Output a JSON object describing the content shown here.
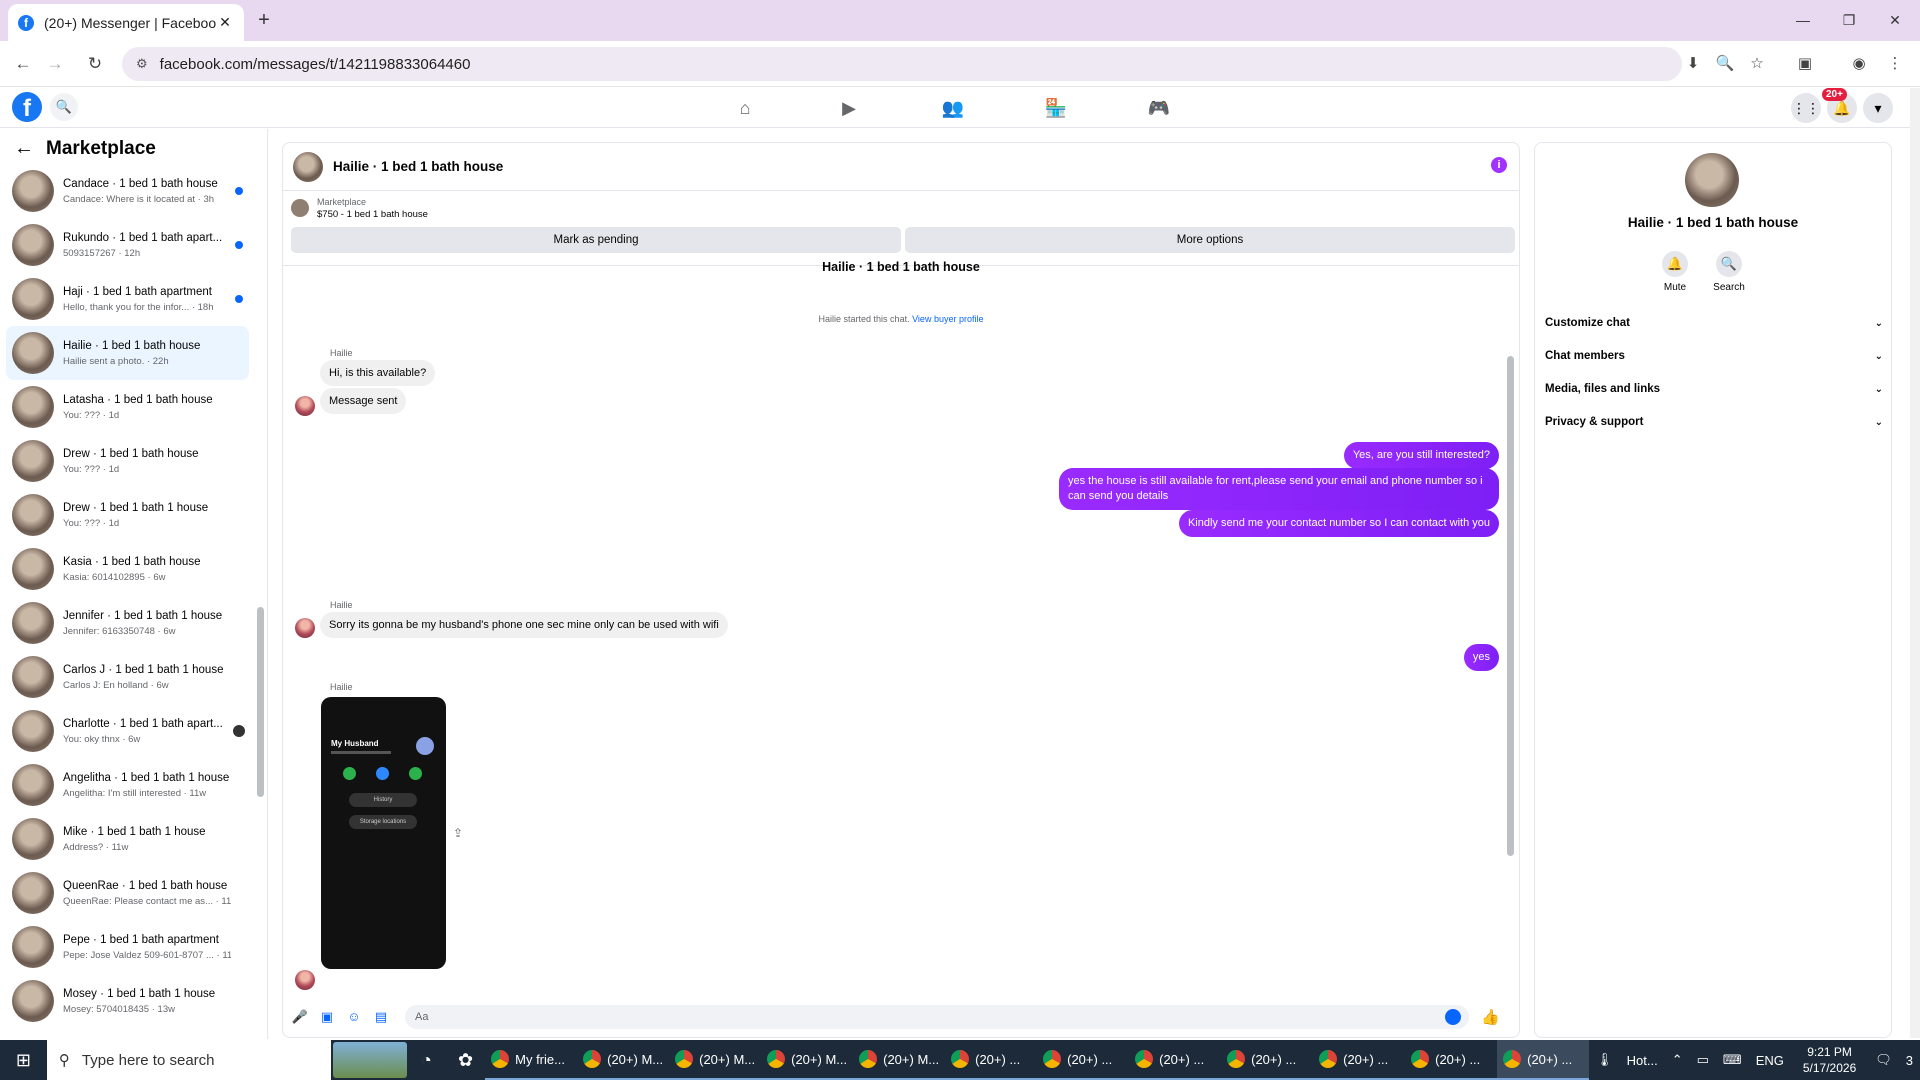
{
  "browser": {
    "tab_title": "(20+) Messenger | Facebook",
    "tab_close": "✕",
    "new_tab": "+",
    "url": "facebook.com/messages/t/1421198833064460",
    "win_min": "—",
    "win_max": "❐",
    "win_close": "✕"
  },
  "fb": {
    "logo": "f",
    "notif_count": "20+"
  },
  "sidebar": {
    "title": "Marketplace",
    "conversations": [
      {
        "name": "Candace · 1 bed 1 bath house",
        "preview": "Candace: Where is it located at · 3h",
        "unread": true
      },
      {
        "name": "Rukundo · 1 bed 1 bath apart...",
        "preview": "5093157267 · 12h",
        "unread": true
      },
      {
        "name": "Haji · 1 bed 1 bath apartment",
        "preview": "Hello, thank you for the infor... · 18h",
        "unread": true
      },
      {
        "name": "Hailie · 1 bed 1 bath house",
        "preview": "Hailie sent a photo. · 22h",
        "active": true
      },
      {
        "name": "Latasha · 1 bed 1 bath house",
        "preview": "You: ??? · 1d"
      },
      {
        "name": "Drew · 1 bed 1 bath house",
        "preview": "You: ??? · 1d"
      },
      {
        "name": "Drew · 1 bed 1 bath 1 house",
        "preview": "You: ??? · 1d"
      },
      {
        "name": "Kasia · 1 bed 1 bath house",
        "preview": "Kasia: 6014102895 · 6w"
      },
      {
        "name": "Jennifer · 1 bed 1 bath 1 house",
        "preview": "Jennifer: 6163350748 · 6w"
      },
      {
        "name": "Carlos J · 1 bed 1 bath 1 house",
        "preview": "Carlos J: En holland · 6w"
      },
      {
        "name": "Charlotte · 1 bed 1 bath apart...",
        "preview": "You: oky thnx · 6w",
        "dark_dot": true
      },
      {
        "name": "Angelitha · 1 bed 1 bath 1 house",
        "preview": "Angelitha: I'm still interested · 11w"
      },
      {
        "name": "Mike · 1 bed 1 bath 1 house",
        "preview": "Address? · 11w"
      },
      {
        "name": "QueenRae · 1 bed 1 bath house",
        "preview": "QueenRae: Please contact me as... · 11w"
      },
      {
        "name": "Pepe · 1 bed 1 bath apartment",
        "preview": "Pepe: Jose Valdez 509-601-8707 ... · 11w"
      },
      {
        "name": "Mosey · 1 bed 1 bath 1 house",
        "preview": "Mosey: 5704018435 · 13w"
      }
    ]
  },
  "chat": {
    "title": "Hailie · 1 bed 1 bath house",
    "listing_label": "Marketplace",
    "listing_title": "$750 - 1 bed 1 bath house",
    "mark_pending": "Mark as pending",
    "more_options": "More options",
    "cut_title": "Hailie · 1 bed 1 bath house",
    "started_text": "Hailie started this chat.",
    "view_profile": "View buyer profile",
    "sender_name": "Hailie",
    "msg_in_1": "Hi, is this available?",
    "msg_in_2": "Message sent",
    "msg_out_1": "Yes, are you still interested?",
    "msg_out_2": "yes the house is still available for rent,please send your email and phone number so i can send you details",
    "msg_out_3": "Kindly send me your contact number so I can contact with you",
    "msg_in_3": "Sorry its gonna be my husband's phone one sec mine only can be used with wifi",
    "msg_out_4": "yes",
    "phone_contact": "My Husband",
    "phone_history": "History",
    "phone_storage": "Storage locations",
    "composer_placeholder": "Aa"
  },
  "right_panel": {
    "name": "Hailie · 1 bed 1 bath house",
    "mute": "Mute",
    "search": "Search",
    "rows": [
      "Customize chat",
      "Chat members",
      "Media, files and links",
      "Privacy & support"
    ]
  },
  "taskbar": {
    "search_placeholder": "Type here to search",
    "apps": [
      "My frie...",
      "(20+) M...",
      "(20+) M...",
      "(20+) M...",
      "(20+) M...",
      "(20+) ...",
      "(20+) ...",
      "(20+) ...",
      "(20+) ...",
      "(20+) ...",
      "(20+) ...",
      "(20+) ..."
    ],
    "weather": "Hot...",
    "lang": "ENG",
    "time": "9:21 PM",
    "date": "5/17/2026",
    "notif": "3"
  }
}
